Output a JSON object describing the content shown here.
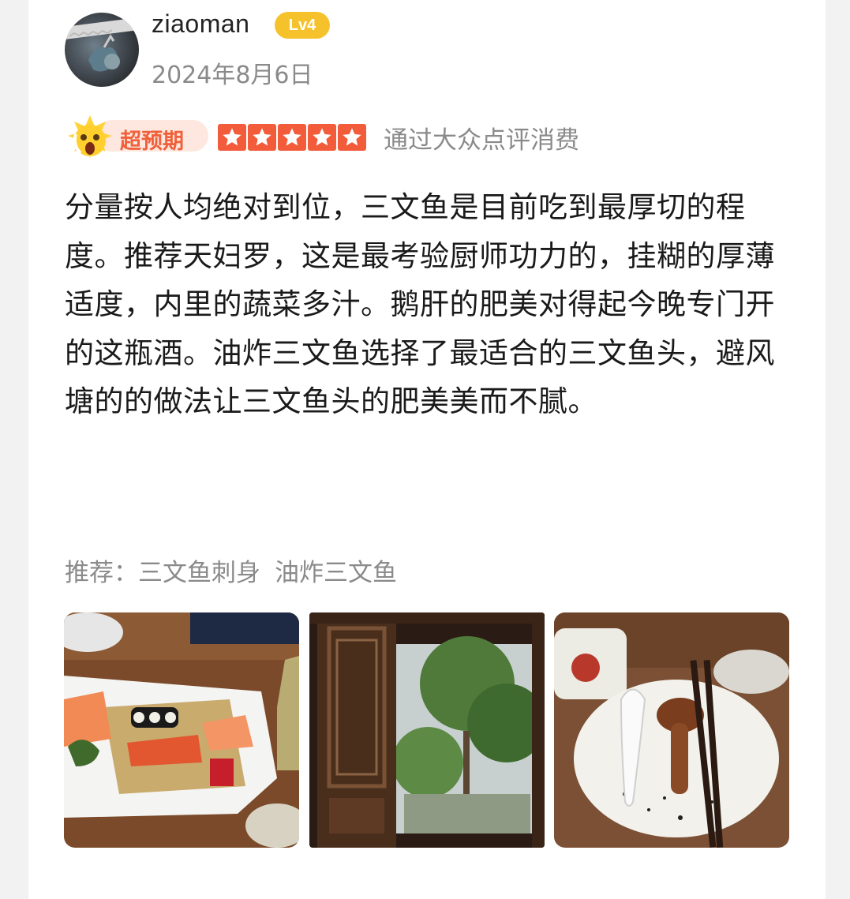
{
  "review": {
    "user": {
      "name": "ziaoman",
      "level": "Lv4",
      "date": "2024年8月6日"
    },
    "rating_badge": "超预期",
    "stars": 5,
    "verified_label": "通过大众点评消费",
    "content": "分量按人均绝对到位，三文鱼是目前吃到最厚切的程度。推荐天妇罗，这是最考验厨师功力的，挂糊的厚薄适度，内里的蔬菜多汁。鹅肝的肥美对得起今晚专门开的这瓶酒。油炸三文鱼选择了最适合的三文鱼头，避风塘的的做法让三文鱼头的肥美美而不腻。",
    "recommend_label": "推荐：",
    "recommend_items": [
      "三文鱼刺身",
      "油炸三文鱼"
    ],
    "colors": {
      "accent_star": "#f25c3b",
      "level_badge": "#f6c22b",
      "expect_text": "#f0603a"
    },
    "photos": [
      "sashimi-platter-photo",
      "window-garden-photo",
      "plate-dessert-photo"
    ]
  }
}
